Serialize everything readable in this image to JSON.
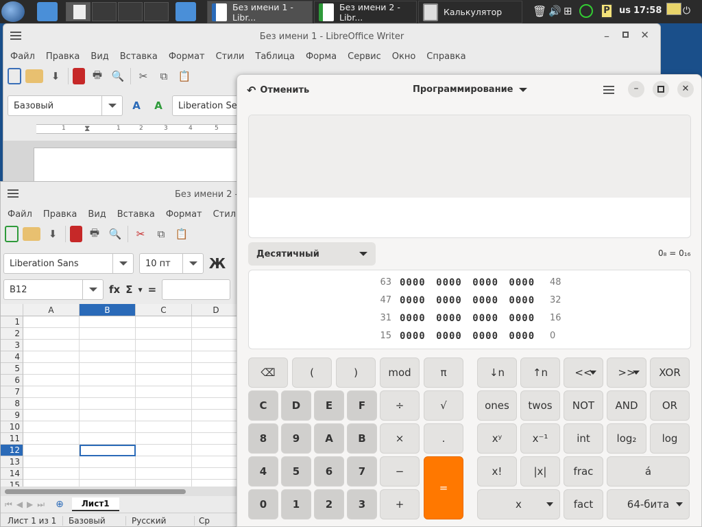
{
  "taskbar": {
    "tasks": [
      {
        "label": "Без имени 1 - Libr..."
      },
      {
        "label": "Без имени 2 - Libr..."
      },
      {
        "label": "Калькулятор"
      }
    ],
    "layout": "us",
    "time": "17:58"
  },
  "writer": {
    "title": "Без имени 1 - LibreOffice Writer",
    "menu": [
      "Файл",
      "Правка",
      "Вид",
      "Вставка",
      "Формат",
      "Стили",
      "Таблица",
      "Форма",
      "Сервис",
      "Окно",
      "Справка"
    ],
    "style_value": "Базовый",
    "font_value": "Liberation Se",
    "ruler_marks": [
      "1",
      "1",
      "2",
      "3",
      "4",
      "5"
    ]
  },
  "calc_sheet": {
    "title": "Без имени 2 -",
    "menu": [
      "Файл",
      "Правка",
      "Вид",
      "Вставка",
      "Формат",
      "Стили"
    ],
    "font_value": "Liberation Sans",
    "size_value": "10 пт",
    "bold_label": "Ж",
    "cell_ref": "B12",
    "fx_label": "fx",
    "sum_label": "Σ",
    "eq_label": "=",
    "columns": [
      "A",
      "B",
      "C",
      "D"
    ],
    "rows": [
      "1",
      "2",
      "3",
      "4",
      "5",
      "6",
      "7",
      "8",
      "9",
      "10",
      "11",
      "12",
      "13",
      "14",
      "15"
    ],
    "sheet_tab": "Лист1",
    "status": [
      "Лист 1 из 1",
      "Базовый",
      "Русский",
      "Ср"
    ]
  },
  "calculator": {
    "undo_label": "Отменить",
    "mode_label": "Программирование",
    "base_label": "Десятичный",
    "conversion": "0₈ = 0₁₆",
    "bits": [
      {
        "left": "63",
        "groups": "0000 0000 0000 0000",
        "right": "48"
      },
      {
        "left": "47",
        "groups": "0000 0000 0000 0000",
        "right": "32"
      },
      {
        "left": "31",
        "groups": "0000 0000 0000 0000",
        "right": "16"
      },
      {
        "left": "15",
        "groups": "0000 0000 0000 0000",
        "right": "0"
      }
    ],
    "keys": {
      "backspace": "⌫",
      "lparen": "(",
      "rparen": ")",
      "mod": "mod",
      "pi": "π",
      "c": "C",
      "d": "D",
      "e": "E",
      "f": "F",
      "div": "÷",
      "sqrt": "√",
      "n8": "8",
      "n9": "9",
      "a": "A",
      "b": "B",
      "mul": "×",
      "dot": ".",
      "n4": "4",
      "n5": "5",
      "n6": "6",
      "n7": "7",
      "minus": "−",
      "eq": "=",
      "n0": "0",
      "n1": "1",
      "n2": "2",
      "n3": "3",
      "plus": "+",
      "shr_n": "↓n",
      "shl_n": "↑n",
      "lshift": "<<",
      "rshift": ">>",
      "xor": "XOR",
      "ones": "ones",
      "twos": "twos",
      "not": "NOT",
      "and": "AND",
      "or": "OR",
      "pow": "xʸ",
      "inv": "x⁻¹",
      "int": "int",
      "log2": "log₂",
      "log": "log",
      "fact_sym": "x!",
      "abs": "|x|",
      "frac": "frac",
      "acute": "á",
      "x": "x",
      "fact": "fact",
      "word": "64-бита"
    }
  }
}
